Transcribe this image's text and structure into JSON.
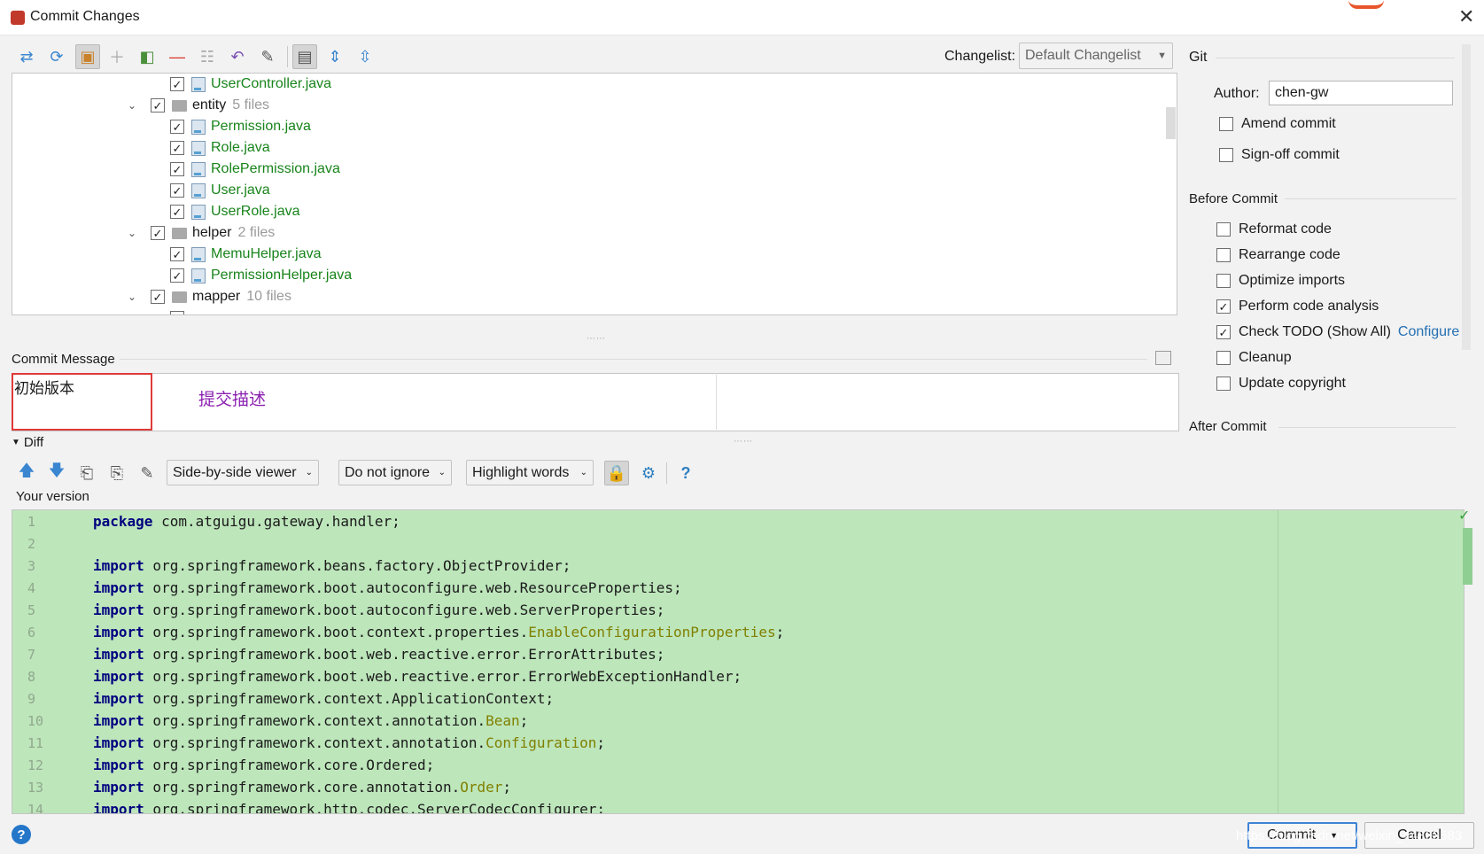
{
  "window": {
    "title": "Commit Changes",
    "close_glyph": "✕"
  },
  "toolbar": {
    "icons": [
      "show-diff-icon",
      "refresh-icon",
      "shelve-icon",
      "add-icon",
      "move-to-changelist-icon",
      "remove-icon",
      "group-by-icon",
      "rollback-icon",
      "edit-source-icon",
      "preview-diff-icon",
      "expand-all-icon",
      "collapse-all-icon"
    ],
    "changelist_label": "Changelist:",
    "changelist_value": "Default Changelist"
  },
  "tree": {
    "rows": [
      {
        "kind": "file",
        "name": "UserController.java",
        "checked": true
      },
      {
        "kind": "folder",
        "name": "entity",
        "count": "5 files",
        "checked": true
      },
      {
        "kind": "file",
        "name": "Permission.java",
        "checked": true
      },
      {
        "kind": "file",
        "name": "Role.java",
        "checked": true
      },
      {
        "kind": "file",
        "name": "RolePermission.java",
        "checked": true
      },
      {
        "kind": "file",
        "name": "User.java",
        "checked": true
      },
      {
        "kind": "file",
        "name": "UserRole.java",
        "checked": true
      },
      {
        "kind": "folder",
        "name": "helper",
        "count": "2 files",
        "checked": true
      },
      {
        "kind": "file",
        "name": "MemuHelper.java",
        "checked": true
      },
      {
        "kind": "file",
        "name": "PermissionHelper.java",
        "checked": true
      },
      {
        "kind": "folder",
        "name": "mapper",
        "count": "10 files",
        "checked": true
      }
    ]
  },
  "git": {
    "section_title": "Git",
    "author_label": "Author:",
    "author_value": "chen-gw",
    "amend_label": "Amend commit",
    "signoff_label": "Sign-off commit"
  },
  "before_commit": {
    "title": "Before Commit",
    "options": [
      {
        "label": "Reformat code",
        "checked": false
      },
      {
        "label": "Rearrange code",
        "checked": false
      },
      {
        "label": "Optimize imports",
        "checked": false
      },
      {
        "label": "Perform code analysis",
        "checked": true
      },
      {
        "label": "Check TODO (Show All)",
        "checked": true
      },
      {
        "label": "Cleanup",
        "checked": false
      },
      {
        "label": "Update copyright",
        "checked": false
      }
    ],
    "configure_link": "Configure"
  },
  "after_commit": {
    "title": "After Commit"
  },
  "commit_message": {
    "label": "Commit Message",
    "text": "初始版本",
    "annotation": "提交描述"
  },
  "diff": {
    "title": "Diff",
    "viewer_select": "Side-by-side viewer",
    "ignore_select": "Do not ignore",
    "highlight_select": "Highlight words",
    "help_glyph": "?",
    "version_label": "Your version",
    "lines": [
      {
        "n": "1",
        "parts": [
          [
            "kw",
            "package"
          ],
          [
            "t",
            " com.atguigu.gateway.handler;"
          ]
        ]
      },
      {
        "n": "2",
        "parts": []
      },
      {
        "n": "3",
        "parts": [
          [
            "kw",
            "import"
          ],
          [
            "t",
            " org.springframework.beans.factory.ObjectProvider;"
          ]
        ]
      },
      {
        "n": "4",
        "parts": [
          [
            "kw",
            "import"
          ],
          [
            "t",
            " org.springframework.boot.autoconfigure.web.ResourceProperties;"
          ]
        ]
      },
      {
        "n": "5",
        "parts": [
          [
            "kw",
            "import"
          ],
          [
            "t",
            " org.springframework.boot.autoconfigure.web.ServerProperties;"
          ]
        ]
      },
      {
        "n": "6",
        "parts": [
          [
            "kw",
            "import"
          ],
          [
            "t",
            " org.springframework.boot.context.properties."
          ],
          [
            "ann",
            "EnableConfigurationProperties"
          ],
          [
            "t",
            ";"
          ]
        ]
      },
      {
        "n": "7",
        "parts": [
          [
            "kw",
            "import"
          ],
          [
            "t",
            " org.springframework.boot.web.reactive.error.ErrorAttributes;"
          ]
        ]
      },
      {
        "n": "8",
        "parts": [
          [
            "kw",
            "import"
          ],
          [
            "t",
            " org.springframework.boot.web.reactive.error.ErrorWebExceptionHandler;"
          ]
        ]
      },
      {
        "n": "9",
        "parts": [
          [
            "kw",
            "import"
          ],
          [
            "t",
            " org.springframework.context.ApplicationContext;"
          ]
        ]
      },
      {
        "n": "10",
        "parts": [
          [
            "kw",
            "import"
          ],
          [
            "t",
            " org.springframework.context.annotation."
          ],
          [
            "ann",
            "Bean"
          ],
          [
            "t",
            ";"
          ]
        ]
      },
      {
        "n": "11",
        "parts": [
          [
            "kw",
            "import"
          ],
          [
            "t",
            " org.springframework.context.annotation."
          ],
          [
            "ann",
            "Configuration"
          ],
          [
            "t",
            ";"
          ]
        ]
      },
      {
        "n": "12",
        "parts": [
          [
            "kw",
            "import"
          ],
          [
            "t",
            " org.springframework.core.Ordered;"
          ]
        ]
      },
      {
        "n": "13",
        "parts": [
          [
            "kw",
            "import"
          ],
          [
            "t",
            " org.springframework.core.annotation."
          ],
          [
            "ann",
            "Order"
          ],
          [
            "t",
            ";"
          ]
        ]
      },
      {
        "n": "14",
        "parts": [
          [
            "kw",
            "import"
          ],
          [
            "t",
            " org.springframework.http.codec.ServerCodecConfigurer;"
          ]
        ]
      }
    ]
  },
  "footer": {
    "help_glyph": "?",
    "commit_label": "Commit",
    "cancel_label": "Cancel",
    "watermark": "https://blog.csdn.net/weixin_44303583"
  },
  "colors": {
    "diff_bg": "#bde6bb",
    "file_green": "#18841b",
    "keyword": "#00007f",
    "annotation": "#808000",
    "highlight_red": "#e03a3a",
    "annotation_purple": "#8b1fb0"
  }
}
